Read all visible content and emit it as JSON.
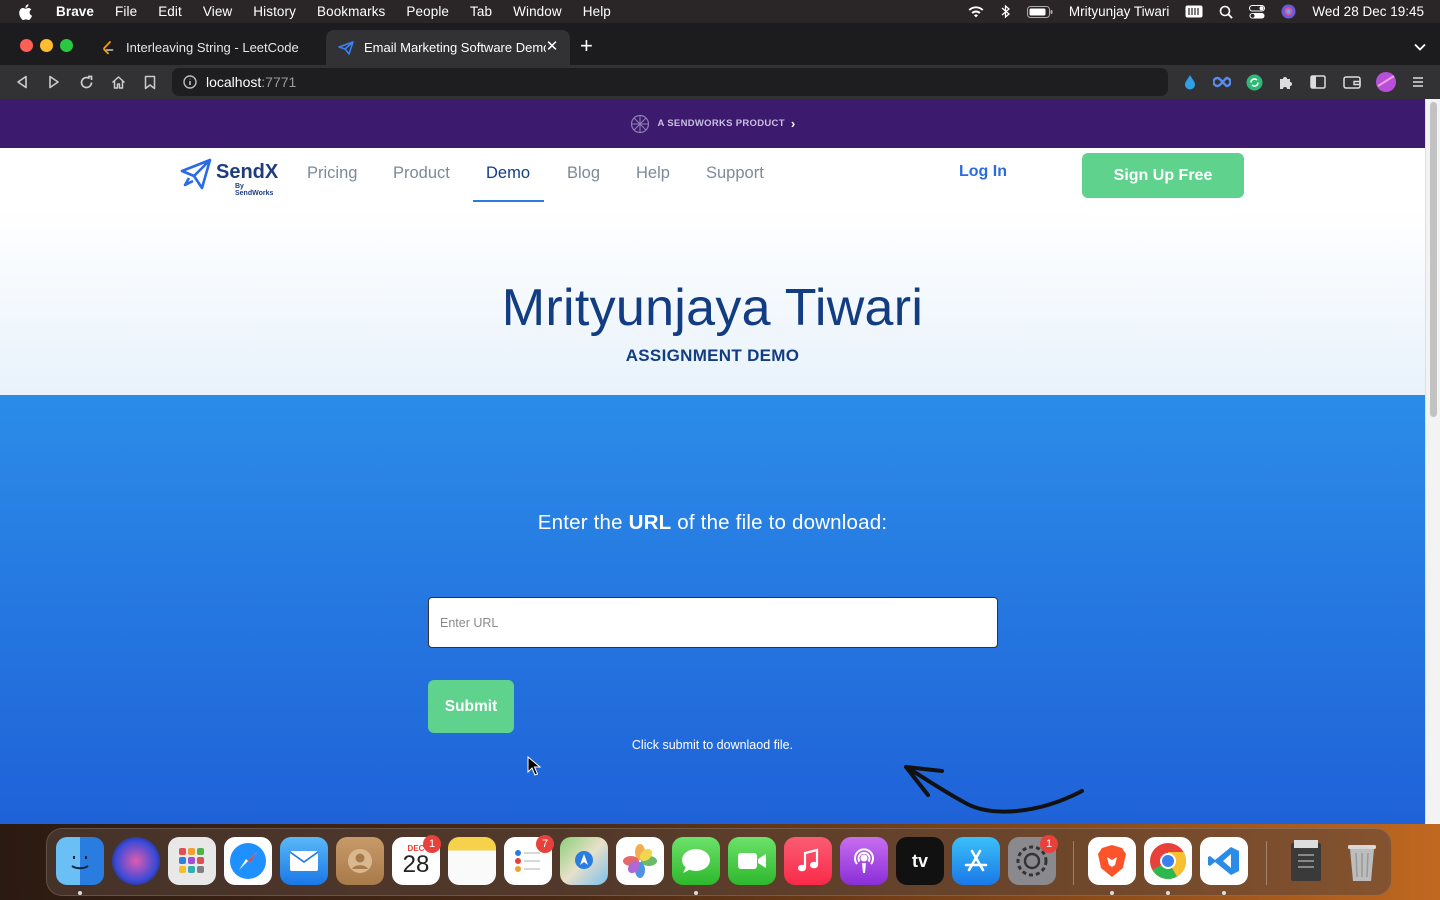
{
  "menubar": {
    "app": "Brave",
    "items": [
      "File",
      "Edit",
      "View",
      "History",
      "Bookmarks",
      "People",
      "Tab",
      "Window",
      "Help"
    ],
    "user": "Mrityunjay Tiwari",
    "datetime": "Wed 28 Dec  19:45"
  },
  "browser": {
    "tabs": [
      {
        "title": "Interleaving String - LeetCode",
        "active": false
      },
      {
        "title": "Email Marketing Software Demo",
        "active": true
      }
    ],
    "url_host": "localhost",
    "url_port": ":7771"
  },
  "page": {
    "promo": "A SENDWORKS PRODUCT",
    "brand_name": "SendX",
    "brand_sub": "By SendWorks",
    "nav": [
      "Pricing",
      "Product",
      "Demo",
      "Blog",
      "Help",
      "Support"
    ],
    "nav_active": "Demo",
    "login": "Log In",
    "signup": "Sign Up Free",
    "hero_title": "Mrityunjaya Tiwari",
    "hero_subtitle": "ASSIGNMENT DEMO",
    "prompt_pre": "Enter the ",
    "prompt_bold": "URL",
    "prompt_post": " of the file to download:",
    "url_placeholder": "Enter URL",
    "submit": "Submit",
    "hint": "Click submit to downlaod file."
  },
  "dock": {
    "apps": [
      "Finder",
      "Siri",
      "Launchpad",
      "Safari",
      "Mail",
      "Contacts",
      "Calendar",
      "Notes",
      "Reminders",
      "Maps",
      "Photos",
      "Messages",
      "FaceTime",
      "Music",
      "Podcasts",
      "TV",
      "App Store",
      "System Preferences",
      "Brave",
      "Chrome",
      "VS Code",
      "Archive",
      "Trash"
    ],
    "calendar_month": "DEC",
    "calendar_day": "28",
    "calendar_badge": "1",
    "reminders_badge": "7",
    "settings_badge": "1",
    "tv_label": "tv"
  },
  "colors": {
    "brand_navy": "#123d82",
    "accent_green": "#5fd38d",
    "promo_purple": "#3c1a6e",
    "blue_top": "#2b8ce8",
    "blue_bottom": "#1f62d8"
  }
}
